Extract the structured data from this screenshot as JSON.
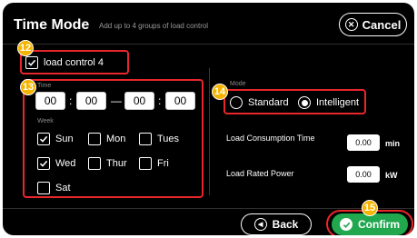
{
  "header": {
    "title": "Time  Mode",
    "subtitle": "Add up to 4 groups of load control",
    "cancel_label": "Cancel"
  },
  "load_control": {
    "label": "load control 4",
    "checked": true
  },
  "time": {
    "label": "Time",
    "start_hour": "00",
    "start_minute": "00",
    "dash": "—",
    "end_hour": "00",
    "end_minute": "00",
    "colon": ":"
  },
  "week": {
    "label": "Week",
    "days": [
      {
        "name": "Sun",
        "checked": true
      },
      {
        "name": "Mon",
        "checked": false
      },
      {
        "name": "Tues",
        "checked": false
      },
      {
        "name": "Wed",
        "checked": true
      },
      {
        "name": "Thur",
        "checked": false
      },
      {
        "name": "Fri",
        "checked": false
      },
      {
        "name": "Sat",
        "checked": false
      }
    ]
  },
  "mode": {
    "label": "Mode",
    "options": [
      {
        "name": "Standard",
        "selected": false
      },
      {
        "name": "Intelligent",
        "selected": true
      }
    ]
  },
  "load_consumption": {
    "label": "Load Consumption Time",
    "value": "0.00",
    "unit": "min"
  },
  "load_power": {
    "label": "Load Rated Power",
    "value": "0.00",
    "unit": "kW"
  },
  "footer": {
    "back_label": "Back",
    "confirm_label": "Confirm"
  },
  "markers": {
    "m12": "12",
    "m13": "13",
    "m14": "14",
    "m15": "15"
  },
  "colors": {
    "highlight": "#e8262b",
    "marker": "#f4b400",
    "confirm": "#21a84f",
    "background": "#000000"
  }
}
